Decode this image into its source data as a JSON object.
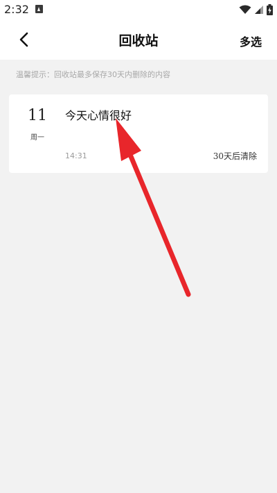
{
  "status_bar": {
    "time": "2:32",
    "icons": [
      "notification-icon",
      "wifi-icon",
      "signal-icon",
      "battery-icon"
    ]
  },
  "app_bar": {
    "back_icon": "chevron-left-icon",
    "title": "回收站",
    "multi_select_label": "多选"
  },
  "hint": {
    "text": "温馨提示：回收站最多保存30天内删除的内容"
  },
  "notes": [
    {
      "day": "11",
      "weekday": "周一",
      "title": "今天心情很好",
      "time": "14:31",
      "expire_label": "30天后清除"
    }
  ],
  "colors": {
    "page_background": "#f2f2f2",
    "card_background": "#ffffff",
    "annotation_arrow": "#e8262b"
  }
}
